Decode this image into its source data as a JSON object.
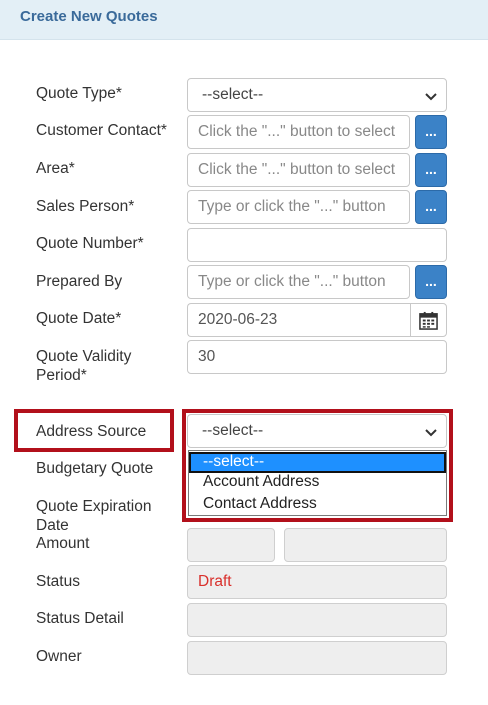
{
  "header": {
    "title": "Create New Quotes"
  },
  "form": {
    "quote_type": {
      "label": "Quote Type*",
      "value": "--select--"
    },
    "customer_contact": {
      "label": "Customer Contact*",
      "placeholder": "Click the \"...\" button to select"
    },
    "area": {
      "label": "Area*",
      "placeholder": "Click the \"...\" button to select"
    },
    "sales_person": {
      "label": "Sales Person*",
      "placeholder": "Type or click the \"...\" button"
    },
    "quote_number": {
      "label": "Quote Number*",
      "value": ""
    },
    "prepared_by": {
      "label": "Prepared By",
      "placeholder": "Type or click the \"...\" button"
    },
    "quote_date": {
      "label": "Quote Date*",
      "value": "2020-06-23"
    },
    "quote_validity": {
      "label_line1": "Quote Validity",
      "label_line2": "Period*",
      "value": "30"
    },
    "address_source": {
      "label": "Address Source",
      "value": "--select--",
      "options": [
        "--select--",
        "Account Address",
        "Contact Address"
      ]
    },
    "budgetary_quote": {
      "label": "Budgetary Quote"
    },
    "quote_expiration": {
      "label_line1": "Quote Expiration",
      "label_line2": "Date"
    },
    "amount": {
      "label": "Amount",
      "value1": "",
      "value2": ""
    },
    "status": {
      "label": "Status",
      "value": "Draft"
    },
    "status_detail": {
      "label": "Status Detail",
      "value": ""
    },
    "owner": {
      "label": "Owner",
      "value": ""
    }
  },
  "buttons": {
    "lookup_label": "..."
  },
  "colors": {
    "header_bg": "#e3eff6",
    "header_text": "#3a6a9a",
    "button_blue": "#3b82c7",
    "highlight_red": "#b2101b",
    "status_red": "#d9302c",
    "option_selected": "#1e90ff"
  },
  "icons": {
    "select_arrow": "chevron-down-icon",
    "calendar": "calendar-icon"
  }
}
